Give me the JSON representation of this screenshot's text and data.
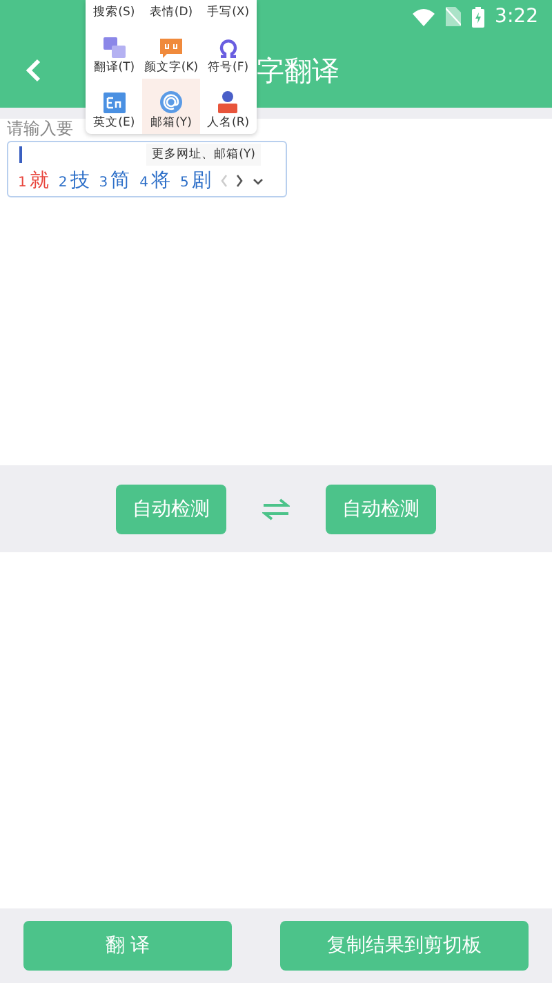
{
  "status_bar": {
    "time": "3:22"
  },
  "header": {
    "title": "字翻译"
  },
  "input": {
    "placeholder": "请输入要"
  },
  "ime_menu": {
    "items": [
      {
        "label": "搜索(S)",
        "kind": "text",
        "selected": false
      },
      {
        "label": "表情(D)",
        "kind": "text",
        "selected": false
      },
      {
        "label": "手写(X)",
        "kind": "text",
        "selected": false
      },
      {
        "label": "翻译(T)",
        "kind": "translate",
        "selected": false
      },
      {
        "label": "颜文字(K)",
        "kind": "kaomoji",
        "selected": false
      },
      {
        "label": "符号(F)",
        "kind": "symbol",
        "selected": false
      },
      {
        "label": "英文(E)",
        "kind": "english",
        "selected": false
      },
      {
        "label": "邮箱(Y)",
        "kind": "email",
        "selected": true
      },
      {
        "label": "人名(R)",
        "kind": "person",
        "selected": false
      }
    ]
  },
  "candidates": {
    "tooltip": "更多网址、邮箱(Y)",
    "items": [
      {
        "index": "1",
        "text": "就",
        "selected": true
      },
      {
        "index": "2",
        "text": "技",
        "selected": false
      },
      {
        "index": "3",
        "text": "简",
        "selected": false
      },
      {
        "index": "4",
        "text": "将",
        "selected": false
      },
      {
        "index": "5",
        "text": "剧",
        "selected": false
      }
    ]
  },
  "language_bar": {
    "source": "自动检测",
    "target": "自动检测"
  },
  "bottom_buttons": [
    "翻 译",
    "复制结果到剪切板"
  ]
}
